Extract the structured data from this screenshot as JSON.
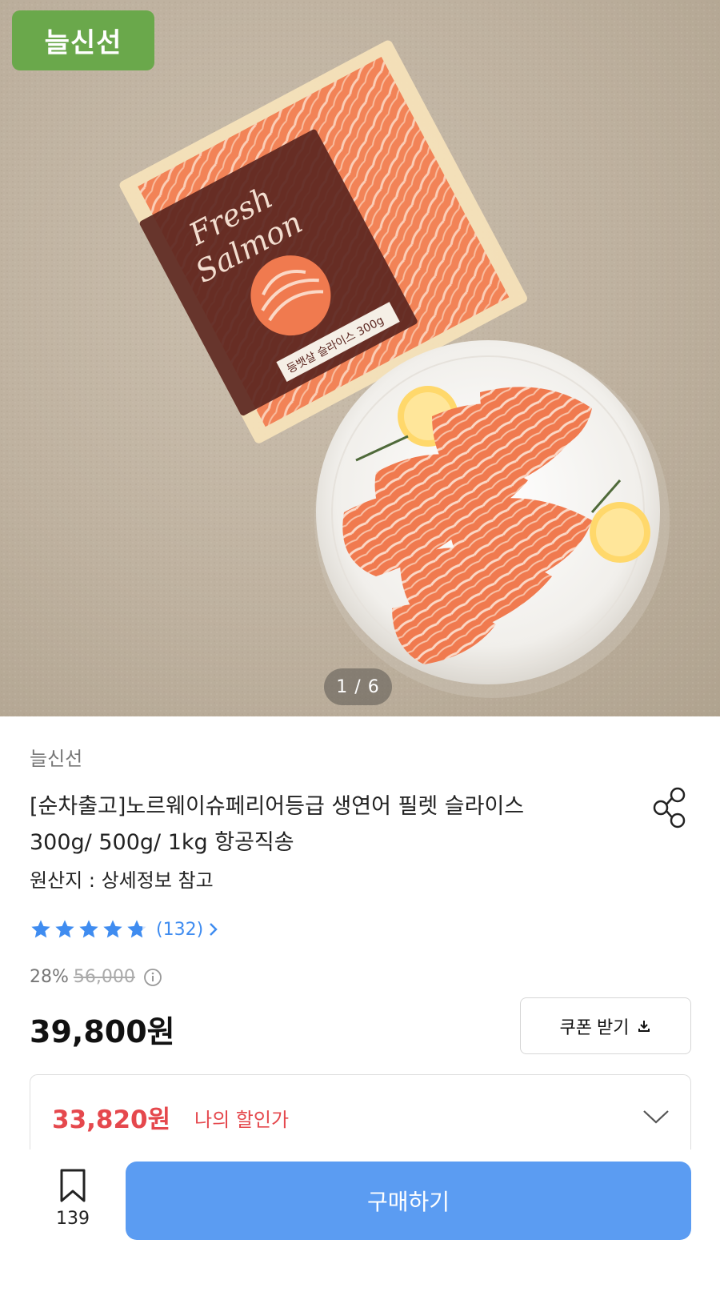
{
  "hero": {
    "brand_badge": "늘신선",
    "image_counter": "1 / 6",
    "package_text_line1": "Fresh",
    "package_text_line2": "Salmon",
    "package_label": "등뱃살 슬라이스 300g"
  },
  "product": {
    "seller": "늘신선",
    "title_line1": "[순차출고]노르웨이슈페리어등급 생연어 필렛 슬라이스",
    "title_line2": "300g/ 500g/ 1kg 항공직송",
    "origin": "원산지 : 상세정보 참고",
    "rating": {
      "stars": 4.8,
      "review_count": "(132)"
    },
    "discount_percent": "28%",
    "original_price": "56,000",
    "price": "39,800원",
    "coupon_button": "쿠폰 받기",
    "my_discount_price": "33,820원",
    "my_discount_label": "나의 할인가"
  },
  "bottom_bar": {
    "bookmark_count": "139",
    "buy_button": "구매하기"
  },
  "colors": {
    "brand_green": "#6aa84b",
    "accent_blue": "#5b9cf2",
    "star_blue": "#3f8cf0",
    "discount_red": "#e5484d"
  },
  "icons": [
    "share-icon",
    "star-icon",
    "chevron-right-icon",
    "info-icon",
    "download-icon",
    "chevron-down-icon",
    "bookmark-icon"
  ]
}
